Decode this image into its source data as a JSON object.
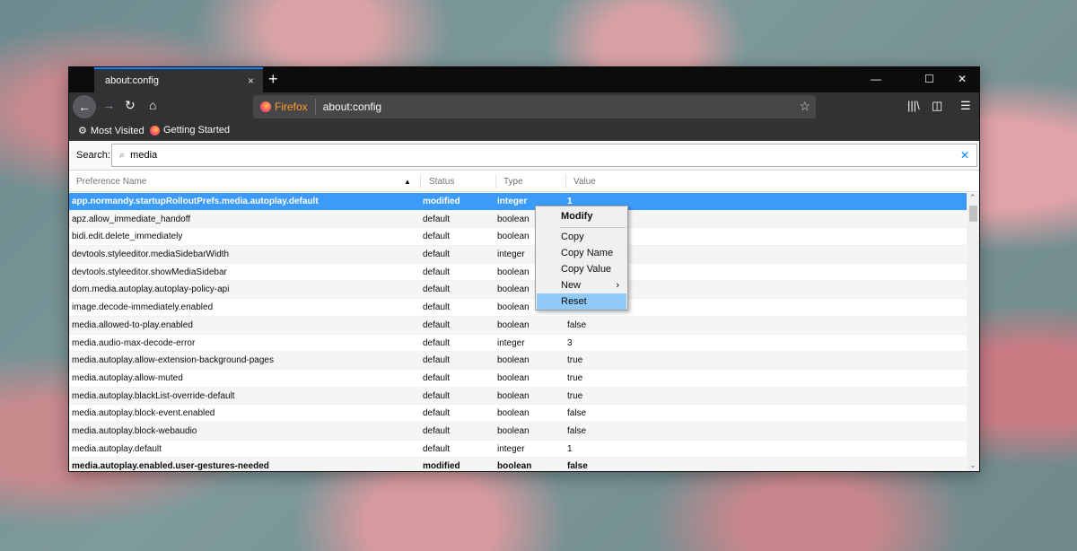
{
  "tab": {
    "title": "about:config",
    "close": "×",
    "new": "+"
  },
  "window_controls": {
    "minimize": "—",
    "maximize": "☐",
    "close": "✕"
  },
  "toolbar": {
    "back": "←",
    "forward": "→",
    "reload": "↻",
    "home": "⌂",
    "identity": "Firefox",
    "url": "about:config",
    "star": "☆",
    "library": "|||\\",
    "sidebar": "◫",
    "menu": "☰"
  },
  "bookmarks": [
    {
      "label": "Most Visited",
      "icon": "gear-icon",
      "glyph": "⚙"
    },
    {
      "label": "Getting Started",
      "icon": "firefox-icon",
      "glyph": ""
    }
  ],
  "search": {
    "label": "Search:",
    "value": "media",
    "glyph": "⌕",
    "clear": "✕"
  },
  "columns": {
    "name": "Preference Name",
    "sort": "▲",
    "status": "Status",
    "type": "Type",
    "value": "Value"
  },
  "rows": [
    {
      "name": "app.normandy.startupRolloutPrefs.media.autoplay.default",
      "status": "modified",
      "type": "integer",
      "value": "1"
    },
    {
      "name": "apz.allow_immediate_handoff",
      "status": "default",
      "type": "boolean",
      "value": ""
    },
    {
      "name": "bidi.edit.delete_immediately",
      "status": "default",
      "type": "boolean",
      "value": ""
    },
    {
      "name": "devtools.styleeditor.mediaSidebarWidth",
      "status": "default",
      "type": "integer",
      "value": ""
    },
    {
      "name": "devtools.styleeditor.showMediaSidebar",
      "status": "default",
      "type": "boolean",
      "value": ""
    },
    {
      "name": "dom.media.autoplay.autoplay-policy-api",
      "status": "default",
      "type": "boolean",
      "value": ""
    },
    {
      "name": "image.decode-immediately.enabled",
      "status": "default",
      "type": "boolean",
      "value": ""
    },
    {
      "name": "media.allowed-to-play.enabled",
      "status": "default",
      "type": "boolean",
      "value": "false"
    },
    {
      "name": "media.audio-max-decode-error",
      "status": "default",
      "type": "integer",
      "value": "3"
    },
    {
      "name": "media.autoplay.allow-extension-background-pages",
      "status": "default",
      "type": "boolean",
      "value": "true"
    },
    {
      "name": "media.autoplay.allow-muted",
      "status": "default",
      "type": "boolean",
      "value": "true"
    },
    {
      "name": "media.autoplay.blackList-override-default",
      "status": "default",
      "type": "boolean",
      "value": "true"
    },
    {
      "name": "media.autoplay.block-event.enabled",
      "status": "default",
      "type": "boolean",
      "value": "false"
    },
    {
      "name": "media.autoplay.block-webaudio",
      "status": "default",
      "type": "boolean",
      "value": "false"
    },
    {
      "name": "media.autoplay.default",
      "status": "default",
      "type": "integer",
      "value": "1"
    },
    {
      "name": "media.autoplay.enabled.user-gestures-needed",
      "status": "modified",
      "type": "boolean",
      "value": "false"
    }
  ],
  "context_menu": {
    "modify": "Modify",
    "copy": "Copy",
    "copy_name": "Copy Name",
    "copy_value": "Copy Value",
    "new": "New",
    "new_arrow": "›",
    "reset": "Reset"
  },
  "scrollbar": {
    "up": "⌃",
    "down": "⌄"
  },
  "colors": {
    "accent": "#0a84ff",
    "selection": "#3c9af8",
    "menu_highlight": "#91c9f7"
  }
}
